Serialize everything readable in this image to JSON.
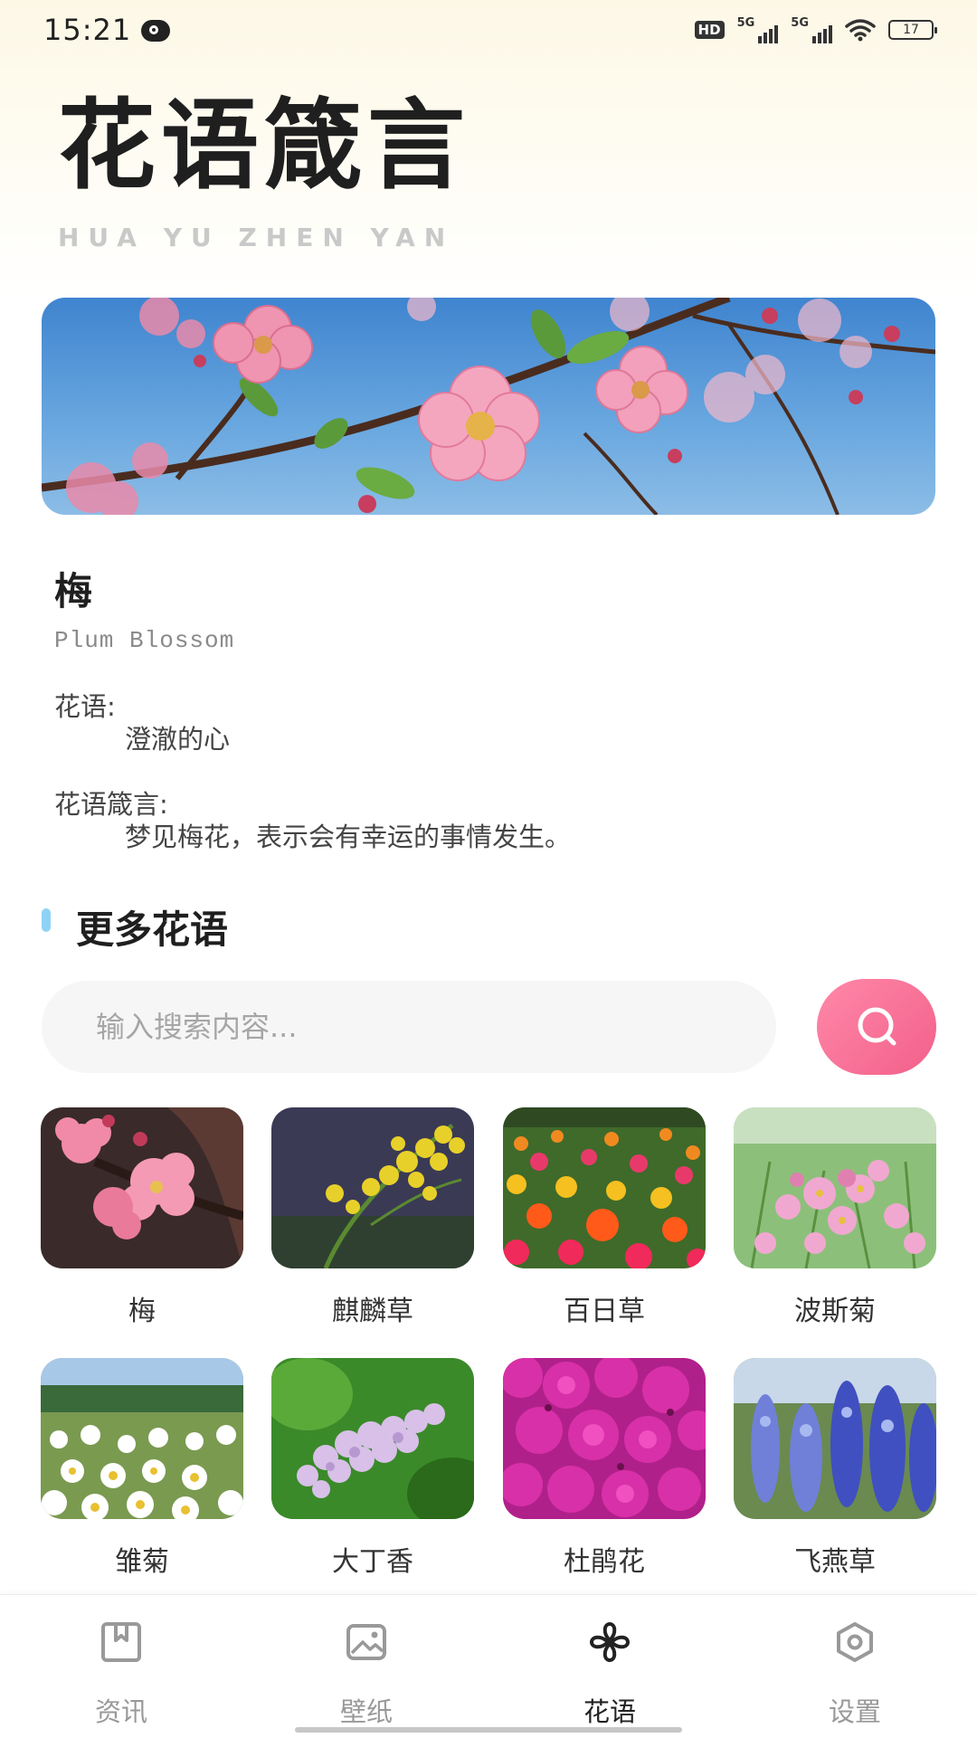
{
  "status_bar": {
    "time": "15:21",
    "hd_badge": "HD",
    "signal1_label": "5G",
    "signal2_label": "5G",
    "battery_level": "17"
  },
  "app": {
    "title": "花语箴言",
    "subtitle": "HUA YU ZHEN YAN"
  },
  "featured": {
    "name": "梅",
    "english_name": "Plum Blossom",
    "language_label": "花语:",
    "language_value": "澄澈的心",
    "saying_label": "花语箴言:",
    "saying_value": "梦见梅花，表示会有幸运的事情发生。"
  },
  "section": {
    "title": "更多花语"
  },
  "search": {
    "placeholder": "输入搜索内容...",
    "value": ""
  },
  "grid": [
    {
      "label": "梅"
    },
    {
      "label": "麒麟草"
    },
    {
      "label": "百日草"
    },
    {
      "label": "波斯菊"
    },
    {
      "label": "雏菊"
    },
    {
      "label": "大丁香"
    },
    {
      "label": "杜鹃花"
    },
    {
      "label": "飞燕草"
    }
  ],
  "nav": [
    {
      "label": "资讯",
      "icon": "bookmark-card-icon",
      "active": false
    },
    {
      "label": "壁纸",
      "icon": "image-icon",
      "active": false
    },
    {
      "label": "花语",
      "icon": "flower-icon",
      "active": true
    },
    {
      "label": "设置",
      "icon": "settings-hexagon-icon",
      "active": false
    }
  ],
  "colors": {
    "accent_pink": "#f2608a",
    "section_bar": "#8ed3f5",
    "text_dark": "#1f1f1f",
    "nav_inactive": "#999999"
  }
}
